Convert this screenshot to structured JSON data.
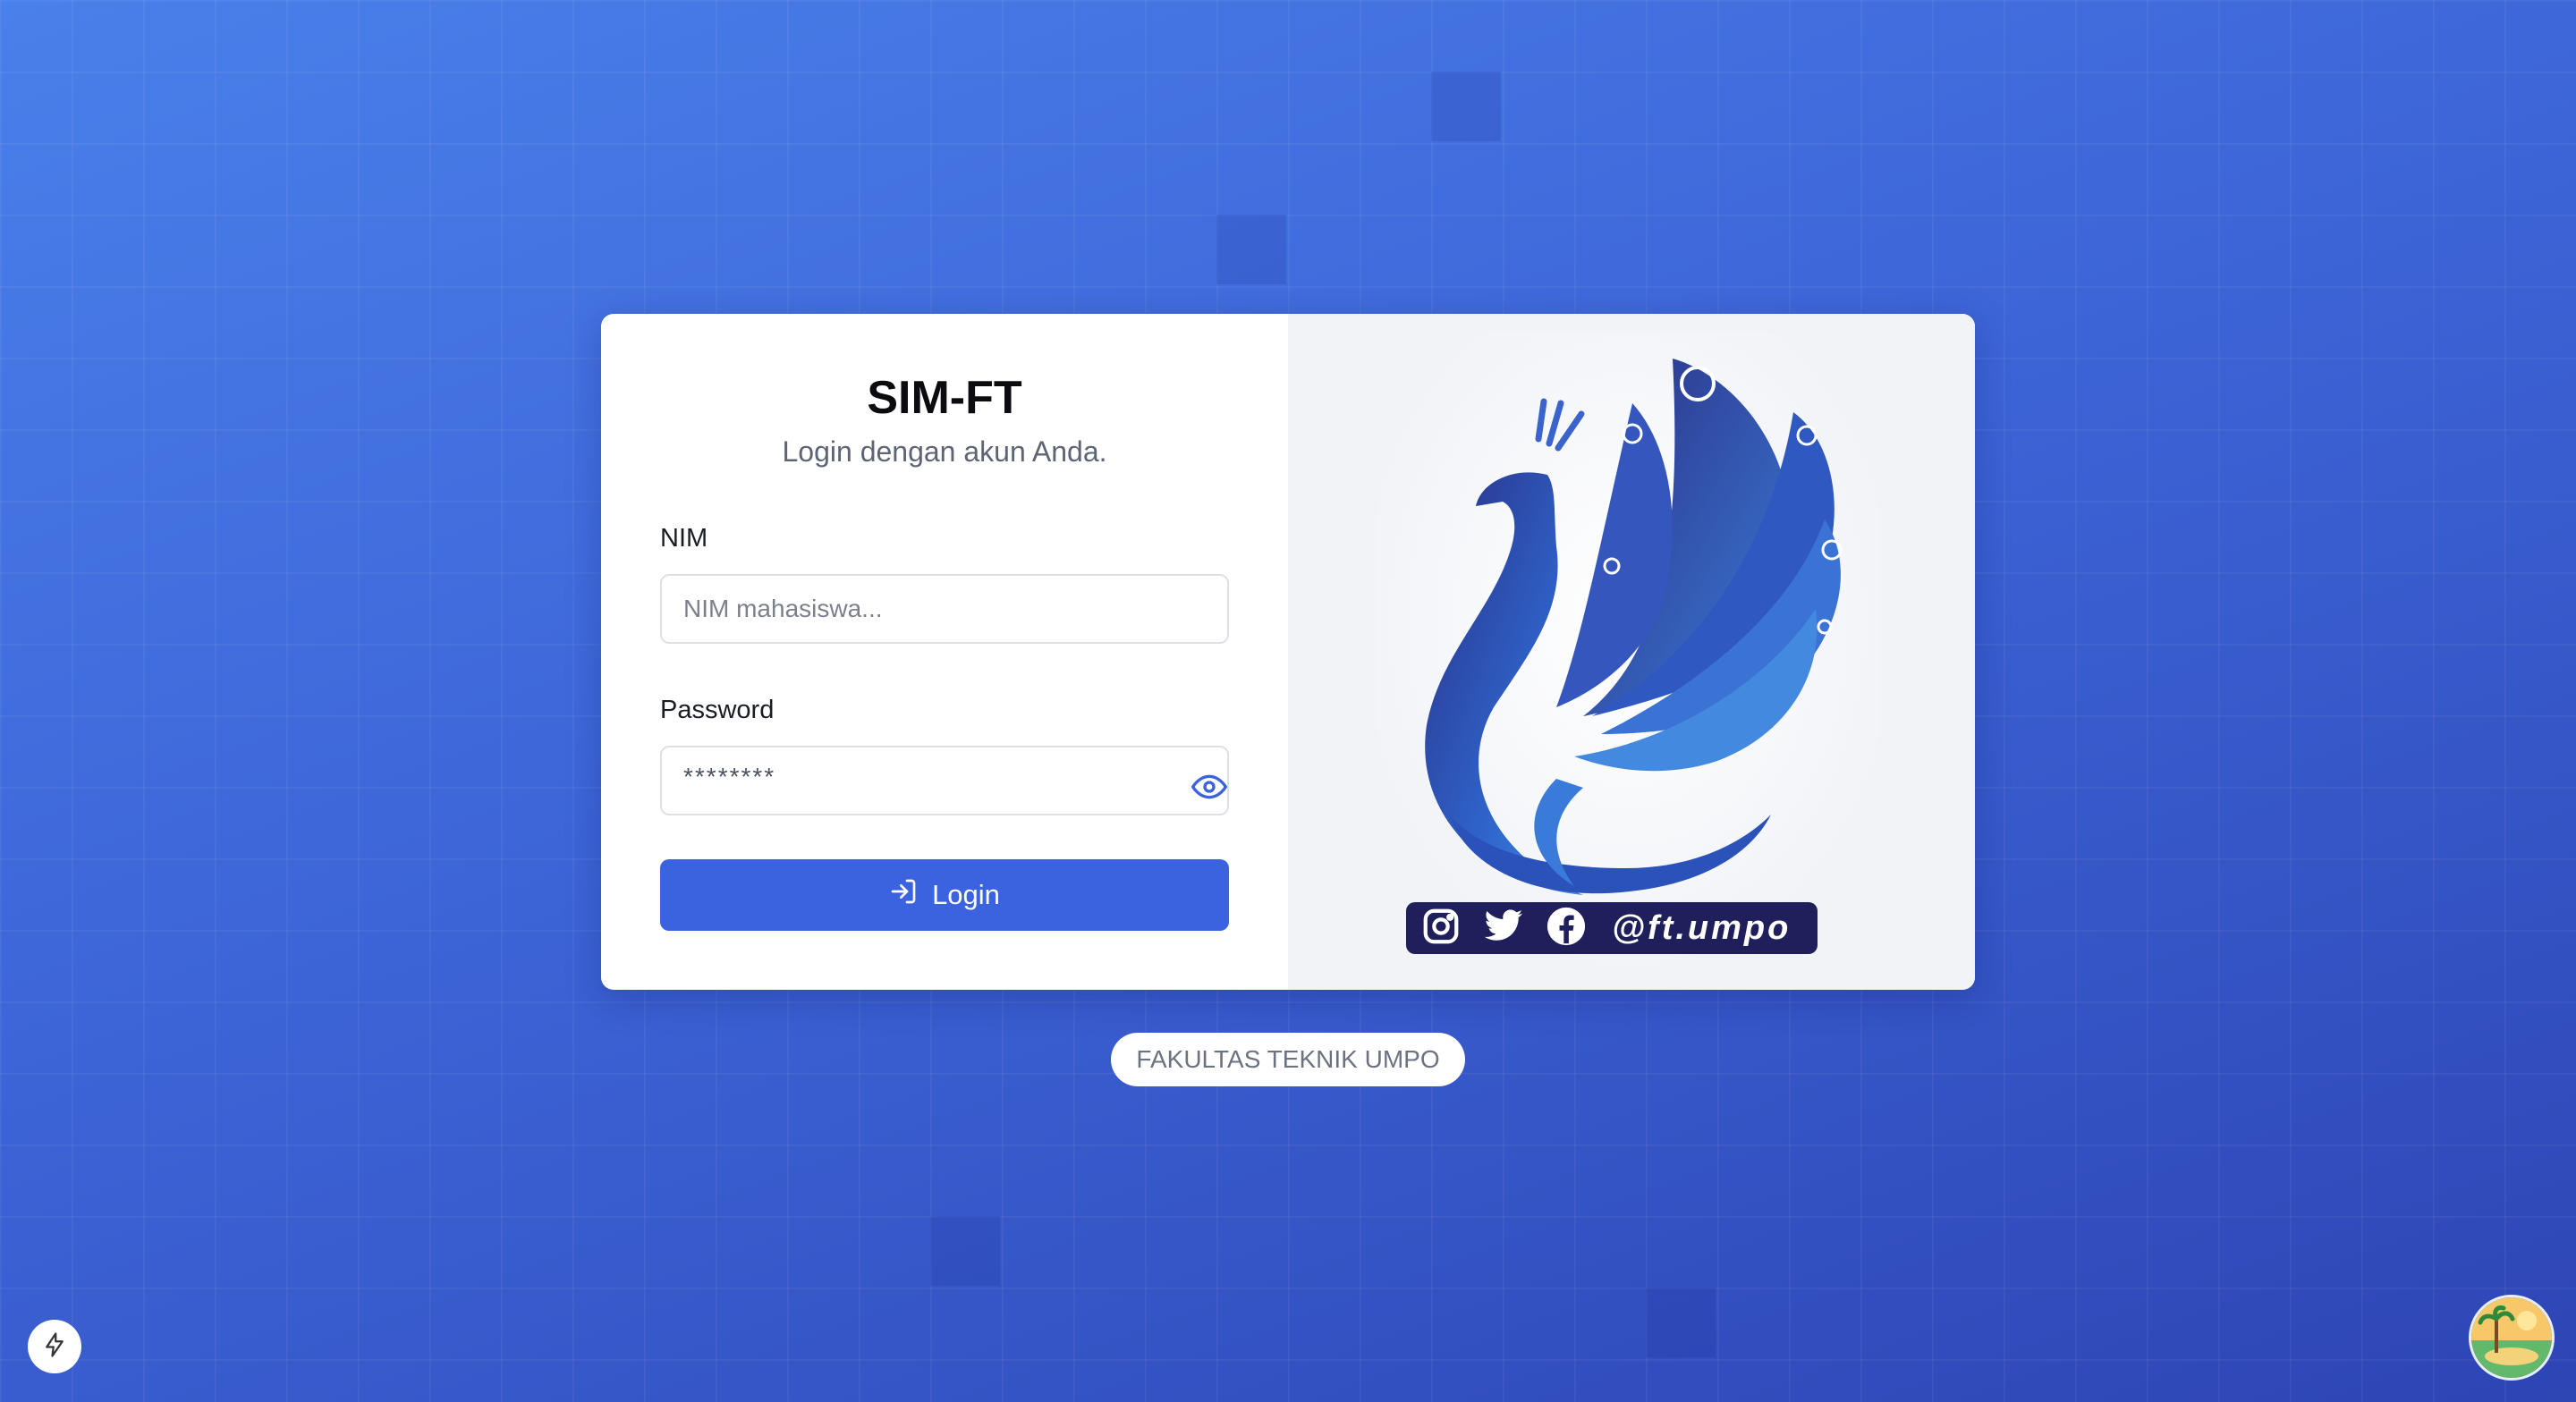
{
  "login_card": {
    "title": "SIM-FT",
    "subtitle": "Login dengan akun Anda.",
    "nim": {
      "label": "NIM",
      "placeholder": "NIM mahasiswa..."
    },
    "password": {
      "label": "Password",
      "masked_value": "********",
      "toggle_icon": "eye-icon"
    },
    "login_button": {
      "label": "Login",
      "icon": "login-arrow-icon"
    }
  },
  "logo_panel": {
    "logo": "peacock-logo",
    "social_handle": "@ft.umpo",
    "social_icons": [
      "instagram-icon",
      "twitter-icon",
      "facebook-icon"
    ]
  },
  "footer": {
    "label": "FAKULTAS TEKNIK UMPO"
  },
  "colors": {
    "accent": "#3b62df",
    "background_start": "#4a80ea",
    "background_end": "#2e45b4",
    "logo_dark": "#1f1f5c"
  }
}
